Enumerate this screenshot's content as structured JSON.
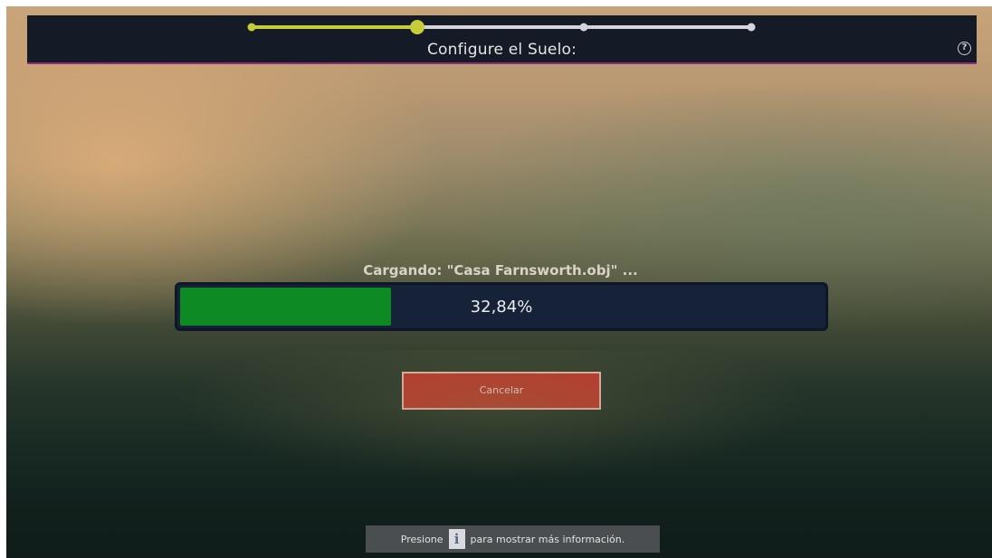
{
  "header": {
    "title": "Configure el Suelo:",
    "help_icon": "question-icon",
    "help_glyph": "?"
  },
  "stepper": {
    "total_steps": 4,
    "current_step": 2,
    "active_color": "#c6cd3a",
    "inactive_color": "#d3d5da"
  },
  "loading": {
    "label": "Cargando: \"Casa Farnsworth.obj\" ...",
    "progress_text": "32,84%",
    "progress_fraction": 0.3284,
    "fill_color": "#0d8a23"
  },
  "actions": {
    "cancel_label": "Cancelar",
    "cancel_color": "#c0352c"
  },
  "hint": {
    "before": "Presione",
    "key": "i",
    "after": "para mostrar más información."
  }
}
